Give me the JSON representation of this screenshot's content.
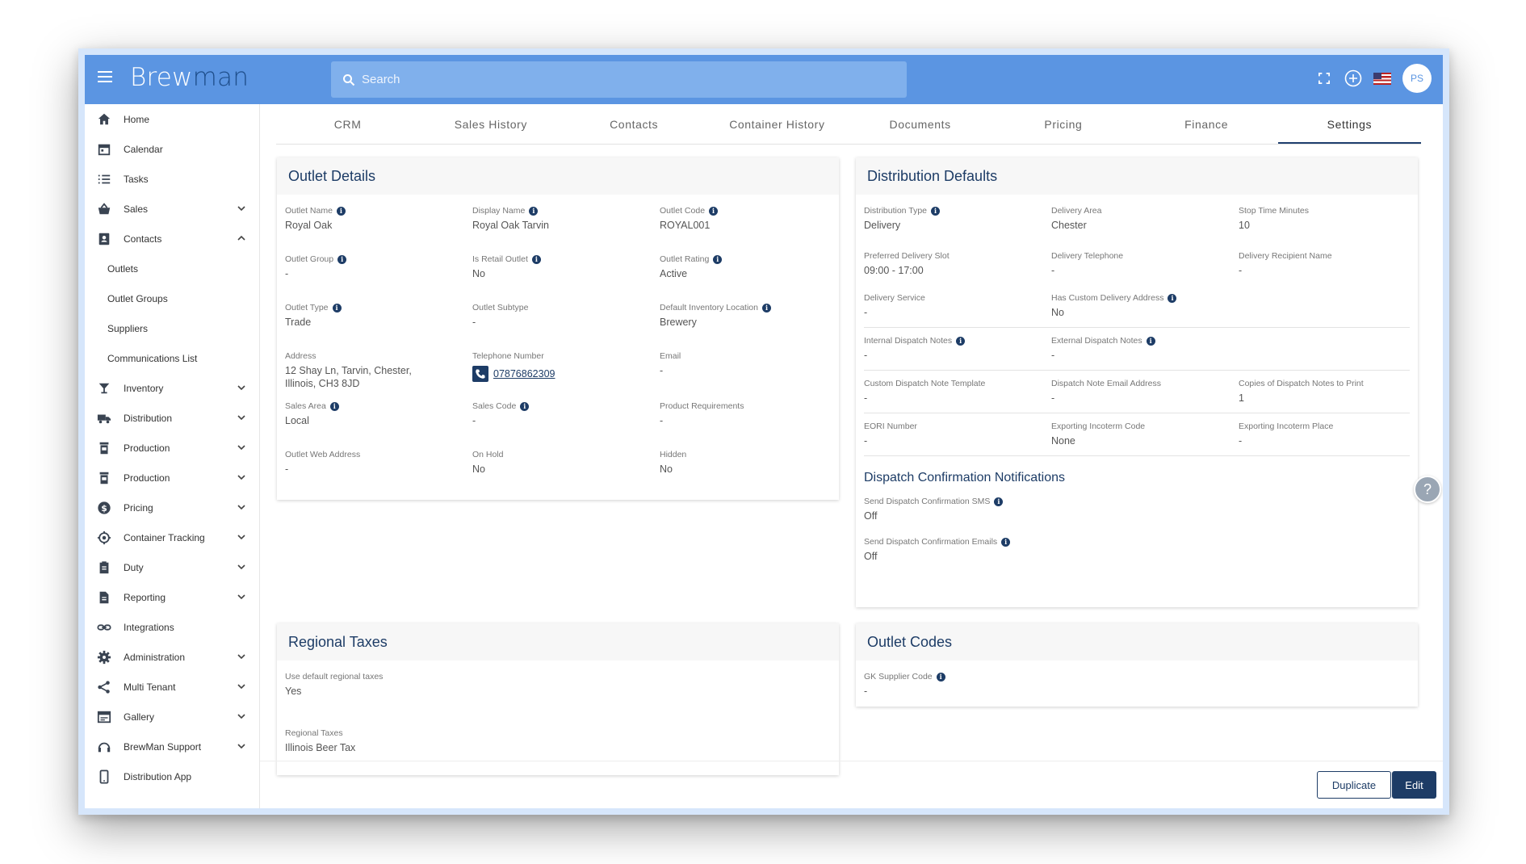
{
  "app": {
    "logo_part1": "Brew",
    "logo_part2": "man",
    "search_placeholder": "Search",
    "avatar_initials": "PS"
  },
  "sidebar": {
    "items": [
      {
        "label": "Home",
        "icon": "home-icon"
      },
      {
        "label": "Calendar",
        "icon": "calendar-icon"
      },
      {
        "label": "Tasks",
        "icon": "list-icon"
      },
      {
        "label": "Sales",
        "icon": "basket-icon"
      },
      {
        "label": "Contacts",
        "icon": "contacts-icon"
      },
      {
        "label": "Outlets"
      },
      {
        "label": "Outlet Groups"
      },
      {
        "label": "Suppliers"
      },
      {
        "label": "Communications List"
      },
      {
        "label": "Inventory",
        "icon": "glass-icon"
      },
      {
        "label": "Distribution",
        "icon": "truck-icon"
      },
      {
        "label": "Production",
        "icon": "tank-icon"
      },
      {
        "label": "Production",
        "icon": "tank-icon"
      },
      {
        "label": "Pricing",
        "icon": "dollar-icon"
      },
      {
        "label": "Container Tracking",
        "icon": "target-icon"
      },
      {
        "label": "Duty",
        "icon": "clipboard-icon"
      },
      {
        "label": "Reporting",
        "icon": "report-icon"
      },
      {
        "label": "Integrations",
        "icon": "link-icon"
      },
      {
        "label": "Administration",
        "icon": "gear-icon"
      },
      {
        "label": "Multi Tenant",
        "icon": "share-icon"
      },
      {
        "label": "Gallery",
        "icon": "gallery-icon"
      },
      {
        "label": "BrewMan Support",
        "icon": "support-icon"
      },
      {
        "label": "Distribution App",
        "icon": "phone-icon"
      }
    ]
  },
  "tabs": [
    "CRM",
    "Sales History",
    "Contacts",
    "Container History",
    "Documents",
    "Pricing",
    "Finance",
    "Settings"
  ],
  "active_tab": "Settings",
  "outlet_details": {
    "title": "Outlet Details",
    "fields": [
      {
        "label": "Outlet Name",
        "value": "Royal Oak",
        "info": true
      },
      {
        "label": "Display Name",
        "value": "Royal Oak Tarvin",
        "info": true
      },
      {
        "label": "Outlet Code",
        "value": "ROYAL001",
        "info": true
      },
      {
        "label": "Outlet Group",
        "value": "-",
        "info": true
      },
      {
        "label": "Is Retail Outlet",
        "value": "No",
        "info": true
      },
      {
        "label": "Outlet Rating",
        "value": "Active",
        "info": true
      },
      {
        "label": "Outlet Type",
        "value": "Trade",
        "info": true
      },
      {
        "label": "Outlet Subtype",
        "value": "-",
        "info": false
      },
      {
        "label": "Default Inventory Location",
        "value": "Brewery",
        "info": true
      },
      {
        "label": "Address",
        "value": "12 Shay Ln, Tarvin, Chester, Illinois, CH3 8JD",
        "info": false
      },
      {
        "label": "Telephone Number",
        "value": "07876862309",
        "info": false
      },
      {
        "label": "Email",
        "value": "-",
        "info": false
      },
      {
        "label": "Sales Area",
        "value": "Local",
        "info": true
      },
      {
        "label": "Sales Code",
        "value": "-",
        "info": true
      },
      {
        "label": "Product Requirements",
        "value": "-",
        "info": false
      },
      {
        "label": "Outlet Web Address",
        "value": "-",
        "info": false
      },
      {
        "label": "On Hold",
        "value": "No",
        "info": false
      },
      {
        "label": "Hidden",
        "value": "No",
        "info": false
      }
    ]
  },
  "distribution_defaults": {
    "title": "Distribution Defaults",
    "fields": [
      {
        "label": "Distribution Type",
        "value": "Delivery",
        "info": true
      },
      {
        "label": "Delivery Area",
        "value": "Chester",
        "info": false
      },
      {
        "label": "Stop Time Minutes",
        "value": "10",
        "info": false
      },
      {
        "label": "Preferred Delivery Slot",
        "value": "09:00 - 17:00",
        "info": false
      },
      {
        "label": "Delivery Telephone",
        "value": "-",
        "info": false
      },
      {
        "label": "Delivery Recipient Name",
        "value": "-",
        "info": false
      },
      {
        "label": "Delivery Service",
        "value": "-",
        "info": false
      },
      {
        "label": "Has Custom Delivery Address",
        "value": "No",
        "info": true
      },
      {
        "label": "",
        "value": "",
        "info": false
      },
      {
        "label": "Internal Dispatch Notes",
        "value": "-",
        "info": true
      },
      {
        "label": "External Dispatch Notes",
        "value": "-",
        "info": true
      },
      {
        "label": "",
        "value": "",
        "info": false
      },
      {
        "label": "Custom Dispatch Note Template",
        "value": "-",
        "info": false
      },
      {
        "label": "Dispatch Note Email Address",
        "value": "-",
        "info": false
      },
      {
        "label": "Copies of Dispatch Notes to Print",
        "value": "1",
        "info": false
      },
      {
        "label": "EORI Number",
        "value": "-",
        "info": false
      },
      {
        "label": "Exporting Incoterm Code",
        "value": "None",
        "info": false
      },
      {
        "label": "Exporting Incoterm Place",
        "value": "-",
        "info": false
      }
    ],
    "notifications_title": "Dispatch Confirmation Notifications",
    "notifications": [
      {
        "label": "Send Dispatch Confirmation SMS",
        "value": "Off"
      },
      {
        "label": "Send Dispatch Confirmation Emails",
        "value": "Off"
      }
    ]
  },
  "regional_taxes": {
    "title": "Regional Taxes",
    "fields": [
      {
        "label": "Use default regional taxes",
        "value": "Yes"
      },
      {
        "label": "Regional Taxes",
        "value": "Illinois Beer Tax"
      }
    ]
  },
  "outlet_codes": {
    "title": "Outlet Codes",
    "fields": [
      {
        "label": "GK Supplier Code",
        "value": "-"
      }
    ]
  },
  "actions": {
    "duplicate": "Duplicate",
    "edit": "Edit"
  },
  "help_icon": "?"
}
